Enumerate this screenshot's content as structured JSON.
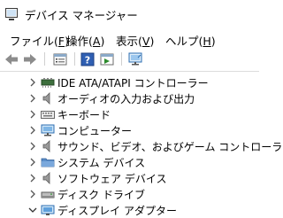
{
  "window": {
    "title": "デバイス マネージャー"
  },
  "menu": {
    "items": [
      {
        "label": "ファイル(",
        "key": "F",
        "suffix": ")"
      },
      {
        "label": "操作(",
        "key": "A",
        "suffix": ")"
      },
      {
        "label": "表示(",
        "key": "V",
        "suffix": ")"
      },
      {
        "label": "ヘルプ(",
        "key": "H",
        "suffix": ")"
      }
    ]
  },
  "toolbar": {
    "icons": [
      "back-arrow-icon",
      "forward-arrow-icon",
      "properties-icon",
      "help-icon",
      "run-icon",
      "scan-hardware-icon"
    ]
  },
  "tree": {
    "items": [
      {
        "label": "IDE ATA/ATAPI コントローラー",
        "icon": "ide-controller-icon",
        "expanded": false
      },
      {
        "label": "オーディオの入力および出力",
        "icon": "speaker-icon",
        "expanded": false
      },
      {
        "label": "キーボード",
        "icon": "keyboard-icon",
        "expanded": false
      },
      {
        "label": "コンピューター",
        "icon": "monitor-icon",
        "expanded": false
      },
      {
        "label": "サウンド、ビデオ、およびゲーム コントローラー",
        "icon": "speaker-icon",
        "expanded": false
      },
      {
        "label": "システム デバイス",
        "icon": "folder-icon",
        "expanded": false
      },
      {
        "label": "ソフトウェア デバイス",
        "icon": "speaker-icon",
        "expanded": false
      },
      {
        "label": "ディスク ドライブ",
        "icon": "disk-drive-icon",
        "expanded": false
      },
      {
        "label": "ディスプレイ アダプター",
        "icon": "display-adapter-icon",
        "expanded": true
      }
    ]
  }
}
